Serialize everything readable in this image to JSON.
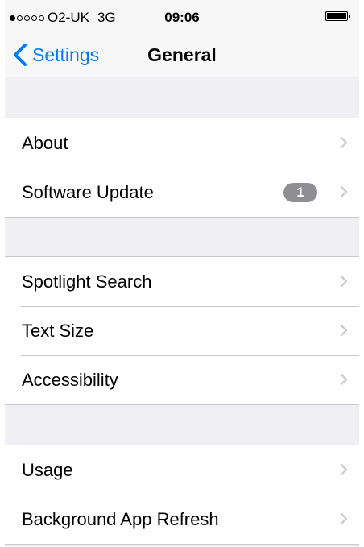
{
  "status_bar": {
    "carrier": "O2-UK",
    "network": "3G",
    "time": "09:06",
    "signal_bars_filled": 1,
    "signal_bars_total": 5
  },
  "nav": {
    "back_label": "Settings",
    "title": "General"
  },
  "groups": [
    {
      "items": [
        {
          "label": "About"
        },
        {
          "label": "Software Update",
          "badge": "1"
        }
      ]
    },
    {
      "items": [
        {
          "label": "Spotlight Search"
        },
        {
          "label": "Text Size"
        },
        {
          "label": "Accessibility"
        }
      ]
    },
    {
      "items": [
        {
          "label": "Usage"
        },
        {
          "label": "Background App Refresh"
        }
      ]
    }
  ],
  "colors": {
    "accent": "#007aff",
    "badge": "#8e8e93",
    "chevron": "#c7c7cc",
    "background": "#efeff4"
  },
  "icons": {
    "back": "chevron-left-icon",
    "disclosure": "chevron-right-icon"
  }
}
